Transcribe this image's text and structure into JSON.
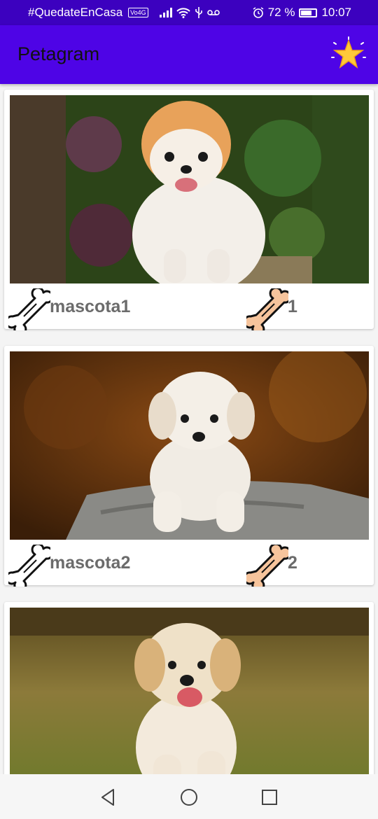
{
  "status_bar": {
    "carrier_text": "#QuedateEnCasa",
    "volte": "Vo4G",
    "battery_percent": "72 %",
    "battery_level": 0.72,
    "time": "10:07"
  },
  "app_bar": {
    "title": "Petagram",
    "favorites_icon": "star-icon"
  },
  "pets": [
    {
      "name": "mascota1",
      "rating": "1",
      "photo": "pomeranian-photo"
    },
    {
      "name": "mascota2",
      "rating": "2",
      "photo": "maltese-puppy-photo"
    },
    {
      "name": "",
      "rating": "",
      "photo": "golden-retriever-puppy-photo"
    }
  ],
  "icons": {
    "like": "bone-outline-icon",
    "rating": "bone-filled-icon"
  },
  "colors": {
    "status_bar": "#3c01bf",
    "app_bar": "#4e04e6",
    "bone_fill": "#f6c49c",
    "text_secondary": "#6b6b6b"
  },
  "nav": [
    "back-icon",
    "home-icon",
    "recents-icon"
  ]
}
